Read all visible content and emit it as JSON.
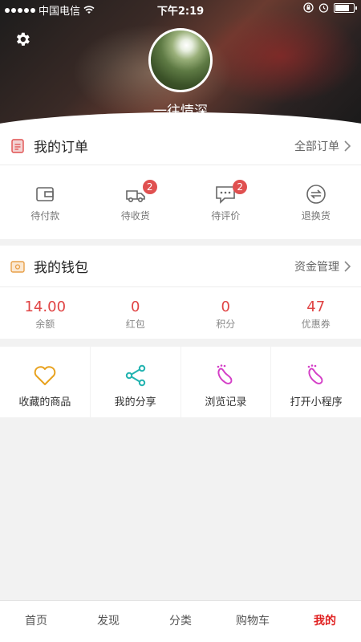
{
  "status_bar": {
    "carrier": "中国电信",
    "time": "下午2:19"
  },
  "profile": {
    "username": "一往情深"
  },
  "orders": {
    "title": "我的订单",
    "more_label": "全部订单",
    "items": [
      {
        "label": "待付款",
        "icon": "wallet-icon",
        "badge": ""
      },
      {
        "label": "待收货",
        "icon": "truck-icon",
        "badge": "2"
      },
      {
        "label": "待评价",
        "icon": "comment-icon",
        "badge": "2"
      },
      {
        "label": "退换货",
        "icon": "exchange-icon",
        "badge": ""
      }
    ]
  },
  "wallet": {
    "title": "我的钱包",
    "more_label": "资金管理",
    "items": [
      {
        "value": "14.00",
        "label": "余额"
      },
      {
        "value": "0",
        "label": "红包"
      },
      {
        "value": "0",
        "label": "积分"
      },
      {
        "value": "47",
        "label": "优惠券"
      }
    ]
  },
  "tools": [
    {
      "label": "收藏的商品",
      "icon": "heart-icon",
      "color": "#e8a21f"
    },
    {
      "label": "我的分享",
      "icon": "share-icon",
      "color": "#22b3b0"
    },
    {
      "label": "浏览记录",
      "icon": "footprint-icon",
      "color": "#d43fc7"
    },
    {
      "label": "打开小程序",
      "icon": "footprint-icon",
      "color": "#d43fc7"
    }
  ],
  "tabbar": [
    {
      "label": "首页"
    },
    {
      "label": "发现"
    },
    {
      "label": "分类"
    },
    {
      "label": "购物车"
    },
    {
      "label": "我的",
      "active": true
    }
  ],
  "colors": {
    "accent": "#e02020",
    "value_red": "#e04444",
    "badge": "#e05050"
  }
}
